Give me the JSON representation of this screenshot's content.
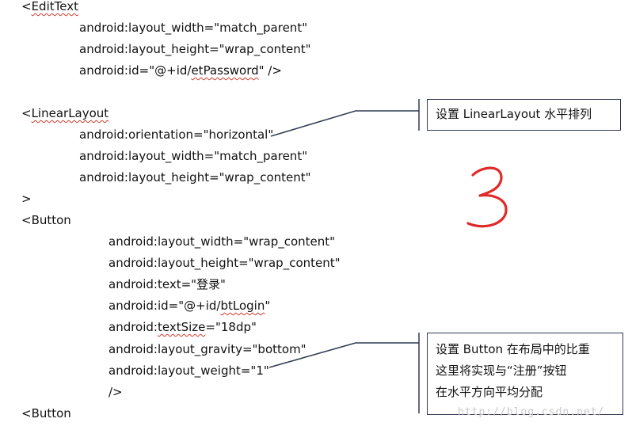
{
  "code_lines": [
    {
      "id": "edittext-open",
      "pre": "<",
      "tag": "EditText",
      "post": ""
    },
    {
      "id": "et-width",
      "attr": "android:layout_width=\"match_parent\""
    },
    {
      "id": "et-height",
      "attr": "android:layout_height=\"wrap_content\""
    },
    {
      "id": "et-id",
      "pre": "android:id=\"@+id/",
      "tag": "etPassword",
      "post": "\" />"
    },
    {
      "id": "ll-open",
      "pre": "<",
      "tag": "LinearLayout",
      "post": ""
    },
    {
      "id": "ll-orientation",
      "attr": "android:orientation=\"horizontal\""
    },
    {
      "id": "ll-width",
      "attr": "android:layout_width=\"match_parent\""
    },
    {
      "id": "ll-height",
      "attr": "android:layout_height=\"wrap_content\""
    },
    {
      "id": "ll-close",
      "attr": ">"
    },
    {
      "id": "button1-open",
      "attr": "<Button"
    },
    {
      "id": "b1-width",
      "attr": "android:layout_width=\"wrap_content\""
    },
    {
      "id": "b1-height",
      "attr": "android:layout_height=\"wrap_content\""
    },
    {
      "id": "b1-text",
      "attr": "android:text=\"登录\""
    },
    {
      "id": "b1-id",
      "pre": "android:id=\"@+id/",
      "tag": "btLogin",
      "post": "\""
    },
    {
      "id": "b1-textsize",
      "pre": "android:",
      "tag": "textSize",
      "post": "=\"18dp\""
    },
    {
      "id": "b1-gravity",
      "attr": "android:layout_gravity=\"bottom\""
    },
    {
      "id": "b1-weight",
      "attr": "android:layout_weight=\"1\""
    },
    {
      "id": "b1-close",
      "attr": "/>"
    },
    {
      "id": "button2-open",
      "attr": "<Button"
    }
  ],
  "callouts": {
    "orientation": [
      "设置 LinearLayout 水平排列"
    ],
    "weight": [
      "设置 Button 在布局中的比重",
      "这里将实现与“注册”按钮",
      "在水平方向平均分配"
    ]
  },
  "handwritten_mark": "3",
  "watermark": "http://blog.csdn.net/",
  "colors": {
    "text": "#111111",
    "spellcheck_underline": "#d23a2a",
    "callout_border": "#2f3b52",
    "handwriting": "#e02a2a",
    "watermark": "#c8c8c8"
  }
}
